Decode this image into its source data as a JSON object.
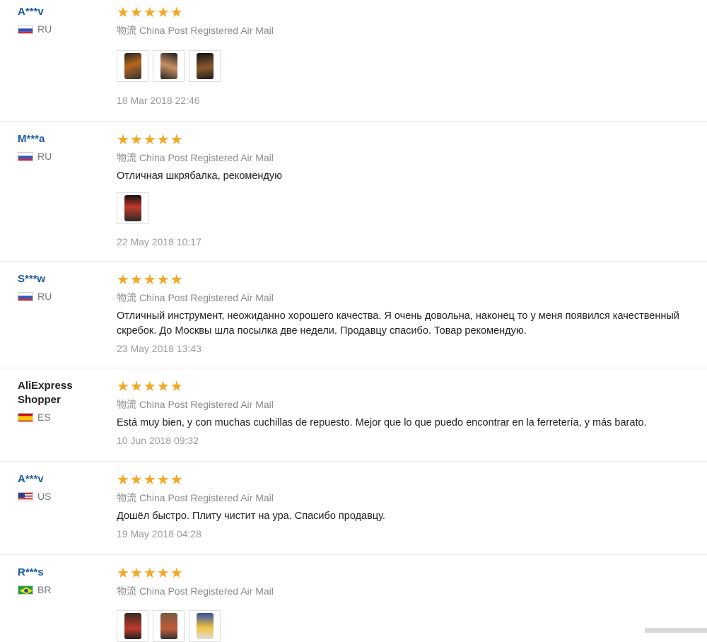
{
  "colors": {
    "star": "#f5a623",
    "username": "#1a5aa8",
    "muted": "#8a8a8a",
    "divider": "#e8e8e8"
  },
  "reviews": [
    {
      "user": "A***v",
      "country": "RU",
      "flag": "flag-ru",
      "rating": "★★★★★",
      "logistics_zh": "物流",
      "logistics": "China Post Registered Air Mail",
      "text": "",
      "photos": 3,
      "date": "18 Mar 2018 22:46"
    },
    {
      "user": "M***a",
      "country": "RU",
      "flag": "flag-ru",
      "rating": "★★★★★",
      "logistics_zh": "物流",
      "logistics": "China Post Registered Air Mail",
      "text": "Отличная шкрябалка, рекомендую",
      "photos": 1,
      "date": "22 May 2018 10:17"
    },
    {
      "user": "S***w",
      "country": "RU",
      "flag": "flag-ru",
      "rating": "★★★★★",
      "logistics_zh": "物流",
      "logistics": "China Post Registered Air Mail",
      "text": "Отличный инструмент, неожиданно хорошего качества. Я очень довольна, наконец то у меня появился качественный скребок. До Москвы шла посылка две недели. Продавцу спасибо. Товар рекомендую.",
      "photos": 0,
      "date": "23 May 2018 13:43"
    },
    {
      "user": "AliExpress Shopper",
      "country": "ES",
      "flag": "flag-es",
      "rating": "★★★★★",
      "logistics_zh": "物流",
      "logistics": "China Post Registered Air Mail",
      "text": "Está muy bien, y con muchas cuchillas de repuesto. Mejor que lo que puedo encontrar en la ferretería, y más barato.",
      "photos": 0,
      "date": "10 Jun 2018 09:32"
    },
    {
      "user": "A***v",
      "country": "US",
      "flag": "flag-us",
      "rating": "★★★★★",
      "logistics_zh": "物流",
      "logistics": "China Post Registered Air Mail",
      "text": "Дошёл быстро. Плиту чистит на ура. Спасибо продавцу.",
      "photos": 0,
      "date": "19 May 2018 04:28"
    },
    {
      "user": "R***s",
      "country": "BR",
      "flag": "flag-br",
      "rating": "★★★★★",
      "logistics_zh": "物流",
      "logistics": "China Post Registered Air Mail",
      "text": "",
      "photos": 3,
      "date": ""
    }
  ]
}
